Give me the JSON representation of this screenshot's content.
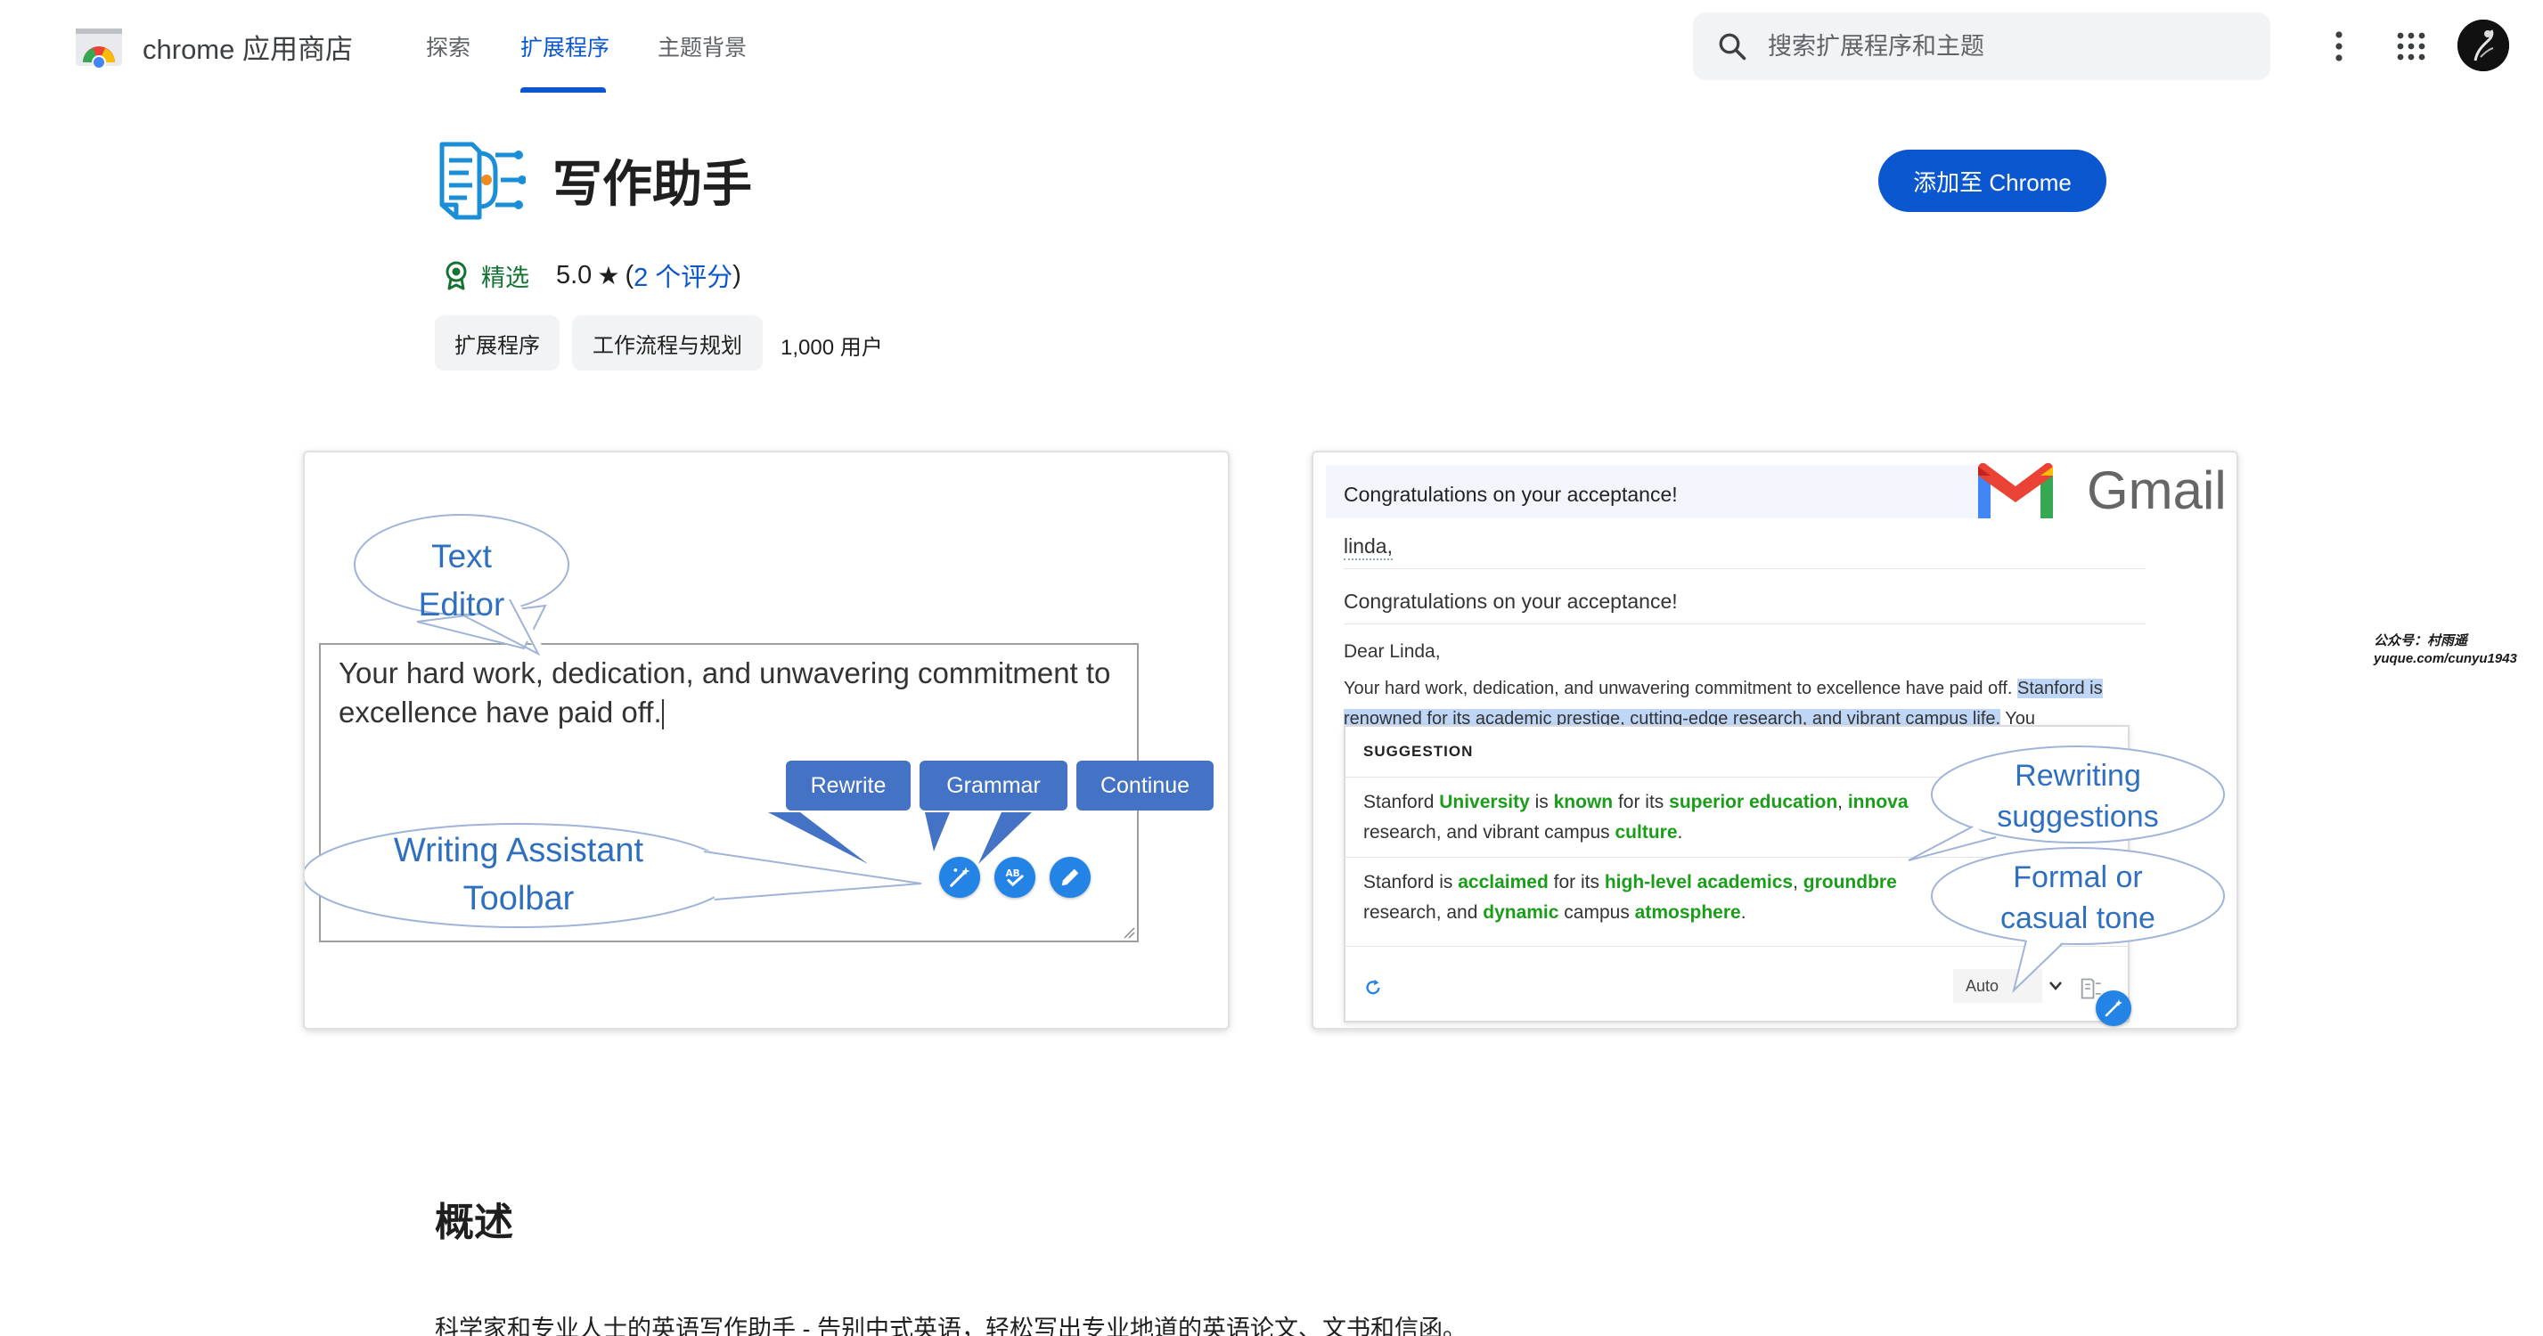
{
  "header": {
    "store_name": "chrome 应用商店",
    "nav": [
      "探索",
      "扩展程序",
      "主题背景"
    ],
    "active_tab": "扩展程序",
    "search_placeholder": "搜索扩展程序和主题",
    "icons": [
      "chrome-web-store-logo",
      "search-icon",
      "more-vert-icon",
      "apps-grid-icon",
      "avatar"
    ],
    "accent_color": "#0b57d0"
  },
  "extension": {
    "title": "写作助手",
    "add_button": "添加至 Chrome",
    "featured_label": "精选",
    "rating": "5.0",
    "ratings_link": "2 个评分",
    "chips": [
      "扩展程序",
      "工作流程与规划"
    ],
    "users": "1,000 用户"
  },
  "screenshot1": {
    "editor_text": "Your hard work, dedication, and unwavering commitment to excellence have paid off.",
    "buttons": [
      "Rewrite",
      "Grammar",
      "Continue"
    ],
    "bubble_editor": [
      "Text",
      "Editor"
    ],
    "bubble_toolbar": [
      "Writing Assistant",
      "Toolbar"
    ]
  },
  "screenshot2": {
    "subject": "Congratulations on your acceptance!",
    "brand": "Gmail",
    "to": "linda,",
    "subject_line": "Congratulations on your acceptance!",
    "greeting": "Dear Linda,",
    "body_plain": "Your hard work, dedication, and unwavering commitment to excellence have paid off. ",
    "body_highlight": "Stanford is renowned for its academic prestige, cutting-edge research, and vibrant campus life.",
    "body_tail": " You",
    "suggestion_header": "SUGGESTION",
    "suggestion1_segments": [
      "Stanford ",
      "University",
      " is ",
      "known",
      " for its ",
      "superior education",
      ", ",
      "innova"
    ],
    "suggestion1_line2_segments": [
      "research, and vibrant campus ",
      "culture",
      "."
    ],
    "suggestion2_segments": [
      "Stanford is ",
      "acclaimed",
      " for its ",
      "high-level academics",
      ", ",
      "groundbre"
    ],
    "suggestion2_line2_segments": [
      "research, and ",
      "dynamic",
      " campus ",
      "atmosphere",
      "."
    ],
    "tone_select": "Auto",
    "bubble_rewrite": [
      "Rewriting",
      "suggestions"
    ],
    "bubble_tone": [
      "Formal or",
      "casual tone"
    ]
  },
  "overview": {
    "title": "概述",
    "text": "科学家和专业人士的英语写作助手 - 告别中式英语，轻松写出专业地道的英语论文、文书和信函。"
  },
  "watermark": [
    "公众号：村雨遥",
    "yuque.com/cunyu1943"
  ]
}
